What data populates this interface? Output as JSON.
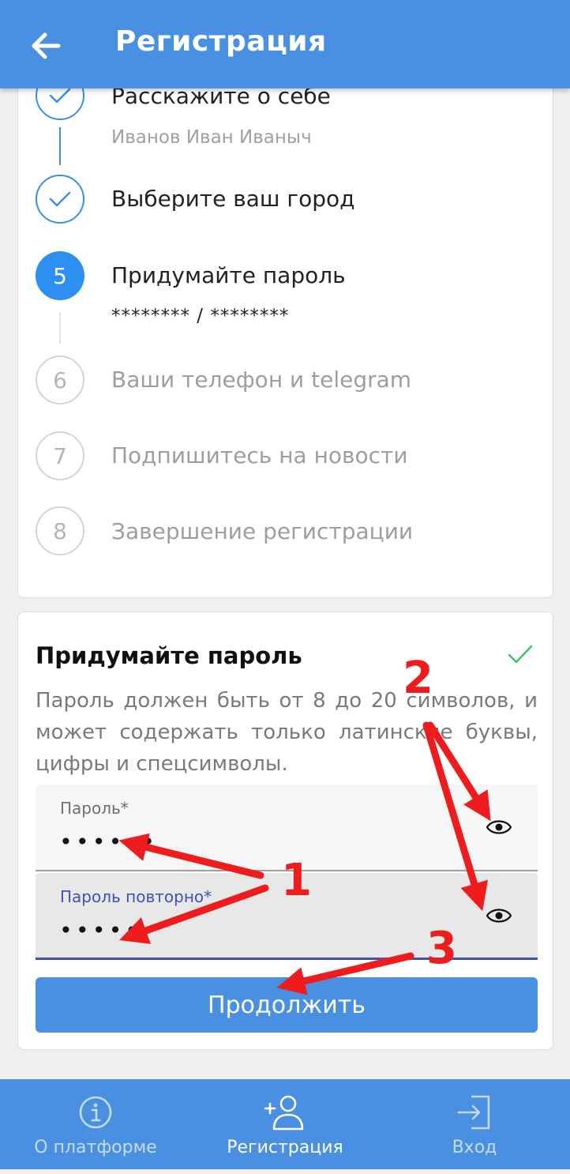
{
  "appbar": {
    "title": "Регистрация",
    "back_icon": "arrow-left-icon"
  },
  "stepper": {
    "steps": [
      {
        "number": "",
        "title": "Расскажите о себе",
        "subtitle": "Иванов Иван Иваныч",
        "state": "done"
      },
      {
        "number": "",
        "title": "Выберите ваш город",
        "subtitle": "",
        "state": "done"
      },
      {
        "number": "5",
        "title": "Придумайте пароль",
        "subtitle": "******** / ********",
        "state": "active"
      },
      {
        "number": "6",
        "title": "Ваши телефон и telegram",
        "subtitle": "",
        "state": "todo"
      },
      {
        "number": "7",
        "title": "Подпишитесь на новости",
        "subtitle": "",
        "state": "todo"
      },
      {
        "number": "8",
        "title": "Завершение регистрации",
        "subtitle": "",
        "state": "todo"
      }
    ]
  },
  "password_card": {
    "title": "Придумайте пароль",
    "hint": "Пароль должен быть от 8 до 20 символов, и может содержать только латинские буквы, цифры и спецсимволы.",
    "password_label": "Пароль*",
    "password_value": "••••••",
    "repeat_label": "Пароль повторно*",
    "repeat_value": "••••••",
    "continue_label": "Продолжить"
  },
  "bottom_nav": {
    "items": [
      {
        "label": "О платформе",
        "icon": "info-icon",
        "active": false
      },
      {
        "label": "Регистрация",
        "icon": "add-user-icon",
        "active": true
      },
      {
        "label": "Вход",
        "icon": "login-icon",
        "active": false
      }
    ]
  },
  "annotations": {
    "labels": [
      "1",
      "2",
      "3"
    ],
    "color": "#ee1c1c"
  },
  "colors": {
    "primary": "#4a90e2",
    "step_active": "#2d8ff0",
    "field_focus": "#3f51b5",
    "success": "#3cc36b"
  }
}
